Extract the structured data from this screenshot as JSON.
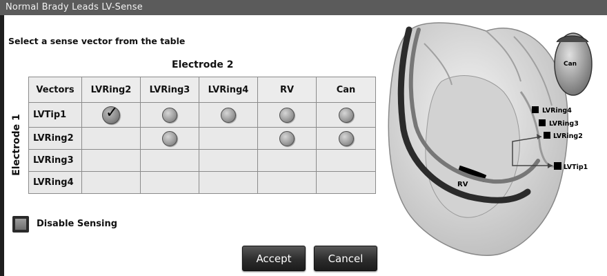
{
  "window": {
    "title": "Normal Brady Leads LV-Sense"
  },
  "instruction": "Select a sense vector from the table",
  "table": {
    "electrode2_label": "Electrode 2",
    "electrode1_label": "Electrode 1",
    "corner_header": "Vectors",
    "columns": [
      "LVRing2",
      "LVRing3",
      "LVRing4",
      "RV",
      "Can"
    ],
    "rows": [
      {
        "label": "LVTip1",
        "cells": [
          "selected",
          "radio",
          "radio",
          "radio",
          "radio"
        ]
      },
      {
        "label": "LVRing2",
        "cells": [
          "empty",
          "radio",
          "empty",
          "radio",
          "radio"
        ]
      },
      {
        "label": "LVRing3",
        "cells": [
          "empty",
          "empty",
          "empty",
          "empty",
          "empty"
        ]
      },
      {
        "label": "LVRing4",
        "cells": [
          "empty",
          "empty",
          "empty",
          "empty",
          "empty"
        ]
      }
    ]
  },
  "disable_sensing": {
    "label": "Disable Sensing",
    "checked": false
  },
  "buttons": {
    "accept": "Accept",
    "cancel": "Cancel"
  },
  "diagram": {
    "labels": {
      "can": "Can",
      "rv": "RV",
      "lvring4": "LVRing4",
      "lvring3": "LVRing3",
      "lvring2": "LVRing2",
      "lvtip1": "LVTip1"
    }
  }
}
